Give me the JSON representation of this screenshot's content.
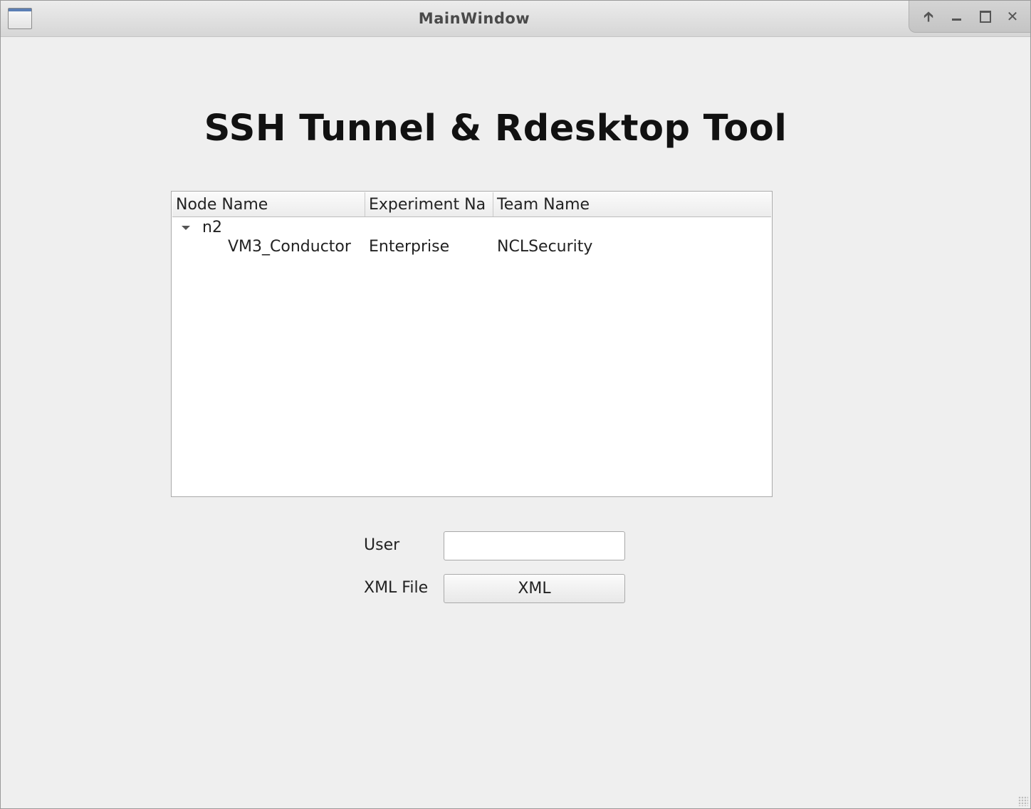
{
  "window": {
    "title": "MainWindow"
  },
  "heading": "SSH Tunnel & Rdesktop Tool",
  "tree": {
    "columns": [
      "Node Name",
      "Experiment Na",
      "Team Name"
    ],
    "parent": {
      "label": "n2",
      "expanded": true
    },
    "rows": [
      {
        "node_name": "VM3_Conductor",
        "experiment_name": "Enterprise",
        "team_name": "NCLSecurity"
      }
    ]
  },
  "form": {
    "user_label": "User",
    "user_value": "",
    "user_placeholder": "",
    "xml_label": "XML File",
    "xml_button_label": "XML"
  },
  "icons": {
    "app": "window-icon",
    "up": "arrow-up-icon",
    "minimize": "minimize-icon",
    "maximize": "maximize-icon",
    "close": "close-icon"
  }
}
